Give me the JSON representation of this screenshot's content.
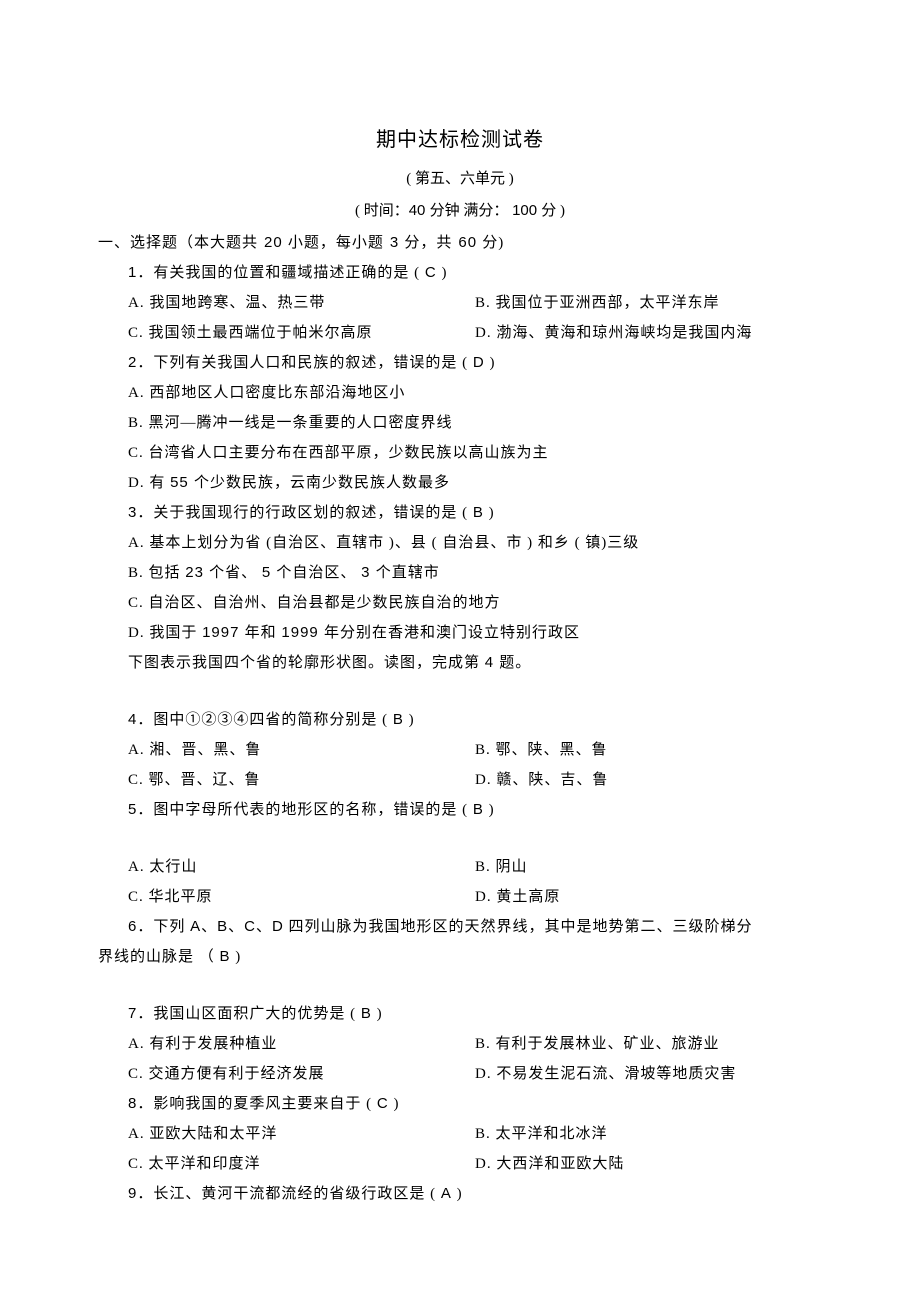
{
  "title": "期中达标检测试卷",
  "subtitle": "( 第五、六单元   )",
  "timing_pre": "( 时间：",
  "timing_min_n": "40 ",
  "timing_min_t": "分钟     满分： ",
  "timing_full_n": "100 ",
  "timing_full_t": "分 )",
  "section_a": "一、选择题（本大题共",
  "section_b": "20 ",
  "section_c": "小题，每小题",
  "section_d": "3 ",
  "section_e": "分，共",
  "section_f": "60 ",
  "section_g": "分)",
  "q1": {
    "num": "1",
    "txt": "．有关我国的位置和疆域描述正确的是       (     ",
    "ans": "C",
    "tail": "   )",
    "A": "A.  我国地跨寒、温、热三带",
    "B": "B.  我国位于亚洲西部，太平洋东岸",
    "C": "C.  我国领土最西端位于帕米尔高原",
    "D": "D.  渤海、黄海和琼州海峡均是我国内海"
  },
  "q2": {
    "num": "2",
    "txt": "．下列有关我国人口和民族的叙述，错误的是       (     ",
    "ans": "D",
    "tail": "   )",
    "A": "A.  西部地区人口密度比东部沿海地区小",
    "B": "B.  黑河—腾冲一线是一条重要的人口密度界线",
    "C": "C.  台湾省人口主要分布在西部平原，少数民族以高山族为主",
    "D_a": "D.  有  ",
    "D_n": "55 ",
    "D_b": "个少数民族，云南少数民族人数最多"
  },
  "q3": {
    "num": "3",
    "txt": "．关于我国现行的行政区划的叙述，错误的是         (     ",
    "ans": "B",
    "tail": "   )",
    "A": "A.  基本上划分为省   (自治区、直辖市   )、县 ( 自治县、市   ) 和乡 ( 镇)三级",
    "B_a": "B.  包括  ",
    "B_n1": "23 ",
    "B_b": "个省、 ",
    "B_n2": "5 ",
    "B_c": "个自治区、 ",
    "B_n3": "3 ",
    "B_d": "个直辖市",
    "C": "C.  自治区、自治州、自治县都是少数民族自治的地方",
    "D_a": "D.  我国于   ",
    "D_n1": "1997 ",
    "D_b": "年和  ",
    "D_n2": "1999 ",
    "D_c": "年分别在香港和澳门设立特别行政区"
  },
  "note1_a": "下图表示我国四个省的轮廓形状图。读图，完成第         ",
  "note1_n": "4 ",
  "note1_b": "题。",
  "q4": {
    "num": "4",
    "txt": "．图中①②③④四省的简称分别是       (     ",
    "ans": "B",
    "tail": "   )",
    "A": "A.  湘、晋、黑、鲁",
    "B": "B.  鄂、陕、黑、鲁",
    "C": "C.  鄂、晋、辽、鲁",
    "D": "D.  赣、陕、吉、鲁"
  },
  "q5": {
    "num": "5",
    "txt": "．图中字母所代表的地形区的名称，错误的是         (     ",
    "ans": "B",
    "tail": "   )",
    "A": "A.  太行山",
    "B": "B.  阴山",
    "C": "C.  华北平原",
    "D": "D.  黄土高原"
  },
  "q6": {
    "num": "6",
    "txt_a": "．下列  ",
    "txt_b": "A、B、C、D",
    "txt_c": " 四列山脉为我国地形区的天然界线，其中是地势第二、三级阶梯分",
    "txt2": "界线的山脉是 （     ",
    "ans": "B",
    "tail": "   )"
  },
  "q7": {
    "num": "7",
    "txt": "．我国山区面积广大的优势是      (     ",
    "ans": "B",
    "tail": "   )",
    "A": "A.  有利于发展种植业",
    "B": "B.  有利于发展林业、矿业、旅游业",
    "C": "C.  交通方便有利于经济发展",
    "D": "D.  不易发生泥石流、滑坡等地质灾害"
  },
  "q8": {
    "num": "8",
    "txt": "．影响我国的夏季风主要来自于       (     ",
    "ans": "C",
    "tail": "   )",
    "A": "A.  亚欧大陆和太平洋",
    "B": "B.  太平洋和北冰洋",
    "C": "C.  太平洋和印度洋",
    "D": "D.  大西洋和亚欧大陆"
  },
  "q9": {
    "num": "9",
    "txt": "．长江、黄河干流都流经的省级行政区是         (     ",
    "ans": "A",
    "tail": "   )"
  }
}
